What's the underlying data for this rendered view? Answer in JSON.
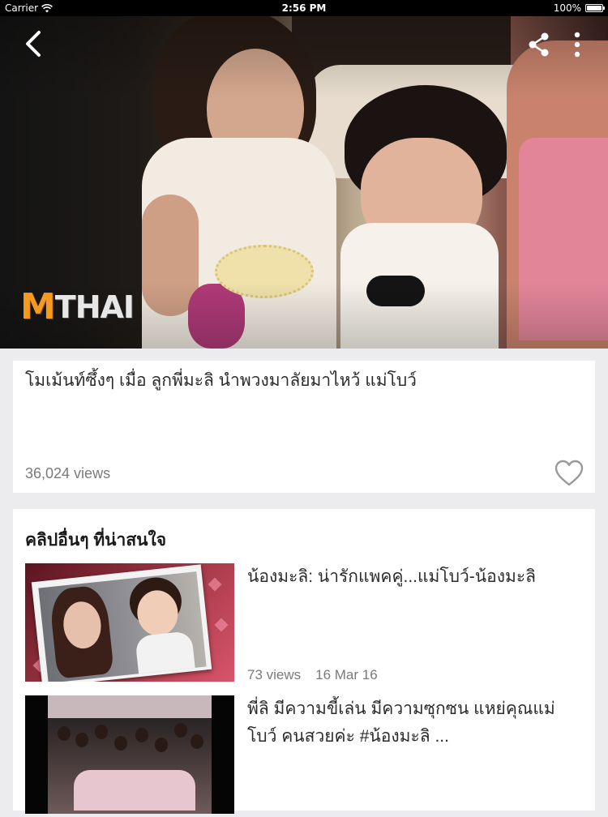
{
  "status_bar": {
    "carrier": "Carrier",
    "time": "2:56 PM",
    "battery": "100%",
    "battery_level": 1.0
  },
  "video": {
    "logo_m": "M",
    "logo_rest": "THAI",
    "back_icon": "chevron-left-icon",
    "share_icon": "share-icon",
    "more_icon": "more-vertical-icon"
  },
  "detail": {
    "title": "โมเม้นท์ซึ้งๆ เมื่อ ลูกพี่มะลิ นำพวงมาลัยมาไหว้ แม่โบว์",
    "views": "36,024 views",
    "favorite_icon": "heart-outline-icon"
  },
  "related": {
    "heading": "คลิปอื่นๆ ที่น่าสนใจ",
    "items": [
      {
        "title": "น้องมะลิ: น่ารักแพคคู่...แม่โบว์-น้องมะลิ",
        "views": "73 views",
        "date": "16 Mar 16"
      },
      {
        "title": "พี่ลิ มีความขี้เล่น มีความซุกซน แหย่คุณแม่โบว์ คนสวยค่ะ #น้องมะลิ ...",
        "views": "",
        "date": ""
      }
    ]
  },
  "colors": {
    "background": "#ececee",
    "card": "#ffffff",
    "logo_orange": "#f49a1e",
    "text_primary": "#2b2b2b",
    "text_secondary": "#7a7a7a"
  }
}
